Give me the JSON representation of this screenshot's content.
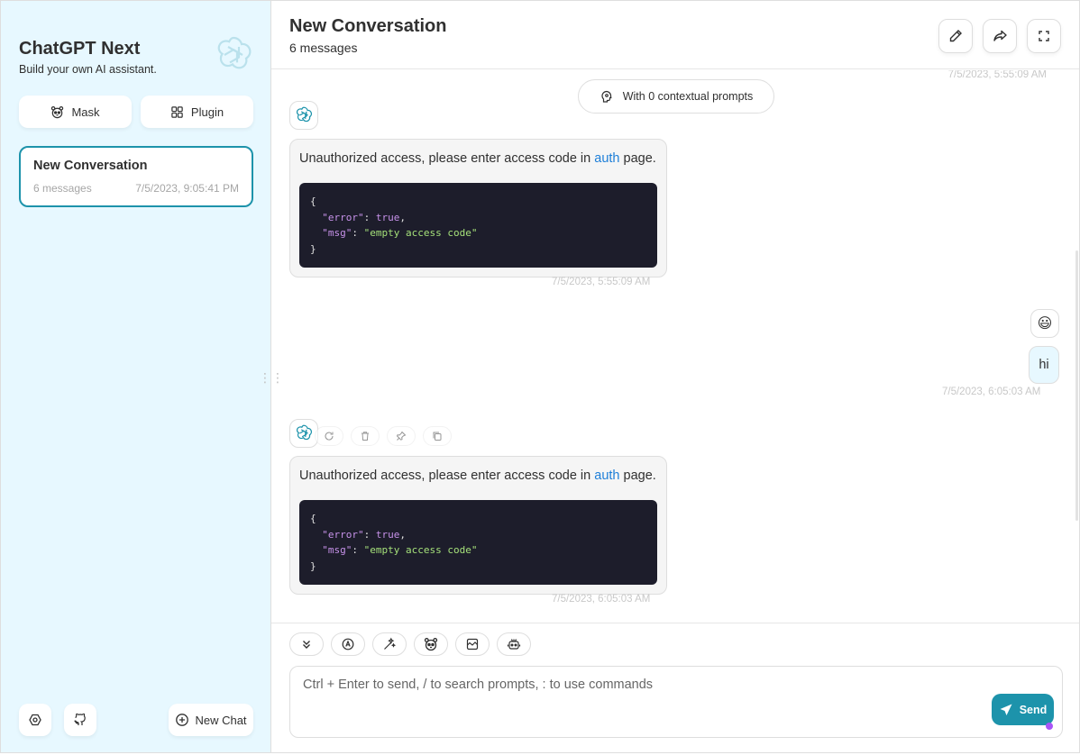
{
  "sidebar": {
    "title": "ChatGPT Next",
    "subtitle": "Build your own AI assistant.",
    "mask_label": "Mask",
    "plugin_label": "Plugin",
    "chats": [
      {
        "title": "New Conversation",
        "count": "6 messages",
        "date": "7/5/2023, 9:05:41 PM"
      }
    ],
    "new_chat_label": "New Chat"
  },
  "header": {
    "title": "New Conversation",
    "subtitle": "6 messages"
  },
  "messages": {
    "top_date": "7/5/2023, 5:55:09 AM",
    "context_label": "With 0 contextual prompts",
    "items": [
      {
        "role": "assistant",
        "text_before": "Unauthorized access, please enter access code in ",
        "link": "auth",
        "text_after": " page.",
        "code": [
          "{",
          "\"error\"",
          "true",
          "\"msg\"",
          "\"empty access code\"",
          "}"
        ],
        "date": "7/5/2023, 5:55:09 AM"
      },
      {
        "role": "user",
        "avatar": "😃",
        "text": "hi",
        "date": "7/5/2023, 6:05:03 AM"
      },
      {
        "role": "assistant",
        "text_before": "Unauthorized access, please enter access code in ",
        "link": "auth",
        "text_after": " page.",
        "code": [
          "{",
          "\"error\"",
          "true",
          "\"msg\"",
          "\"empty access code\"",
          "}"
        ],
        "date": "7/5/2023, 6:05:03 AM"
      }
    ]
  },
  "input": {
    "placeholder": "Ctrl + Enter to send, / to search prompts, : to use commands",
    "send_label": "Send"
  },
  "colors": {
    "accent": "#1d93ab",
    "sidebar_bg": "#e7f8ff",
    "code_bg": "#1d1d2b"
  },
  "icons": [
    "openai-logo-icon",
    "mask-icon",
    "plugin-icon",
    "settings-icon",
    "github-icon",
    "add-icon",
    "edit-icon",
    "share-icon",
    "maximize-icon",
    "brain-icon",
    "reload-icon",
    "delete-icon",
    "pin-icon",
    "copy-icon",
    "scroll-bottom-icon",
    "theme-icon",
    "prompt-icon",
    "mask-icon",
    "break-icon",
    "robot-icon",
    "send-icon"
  ]
}
